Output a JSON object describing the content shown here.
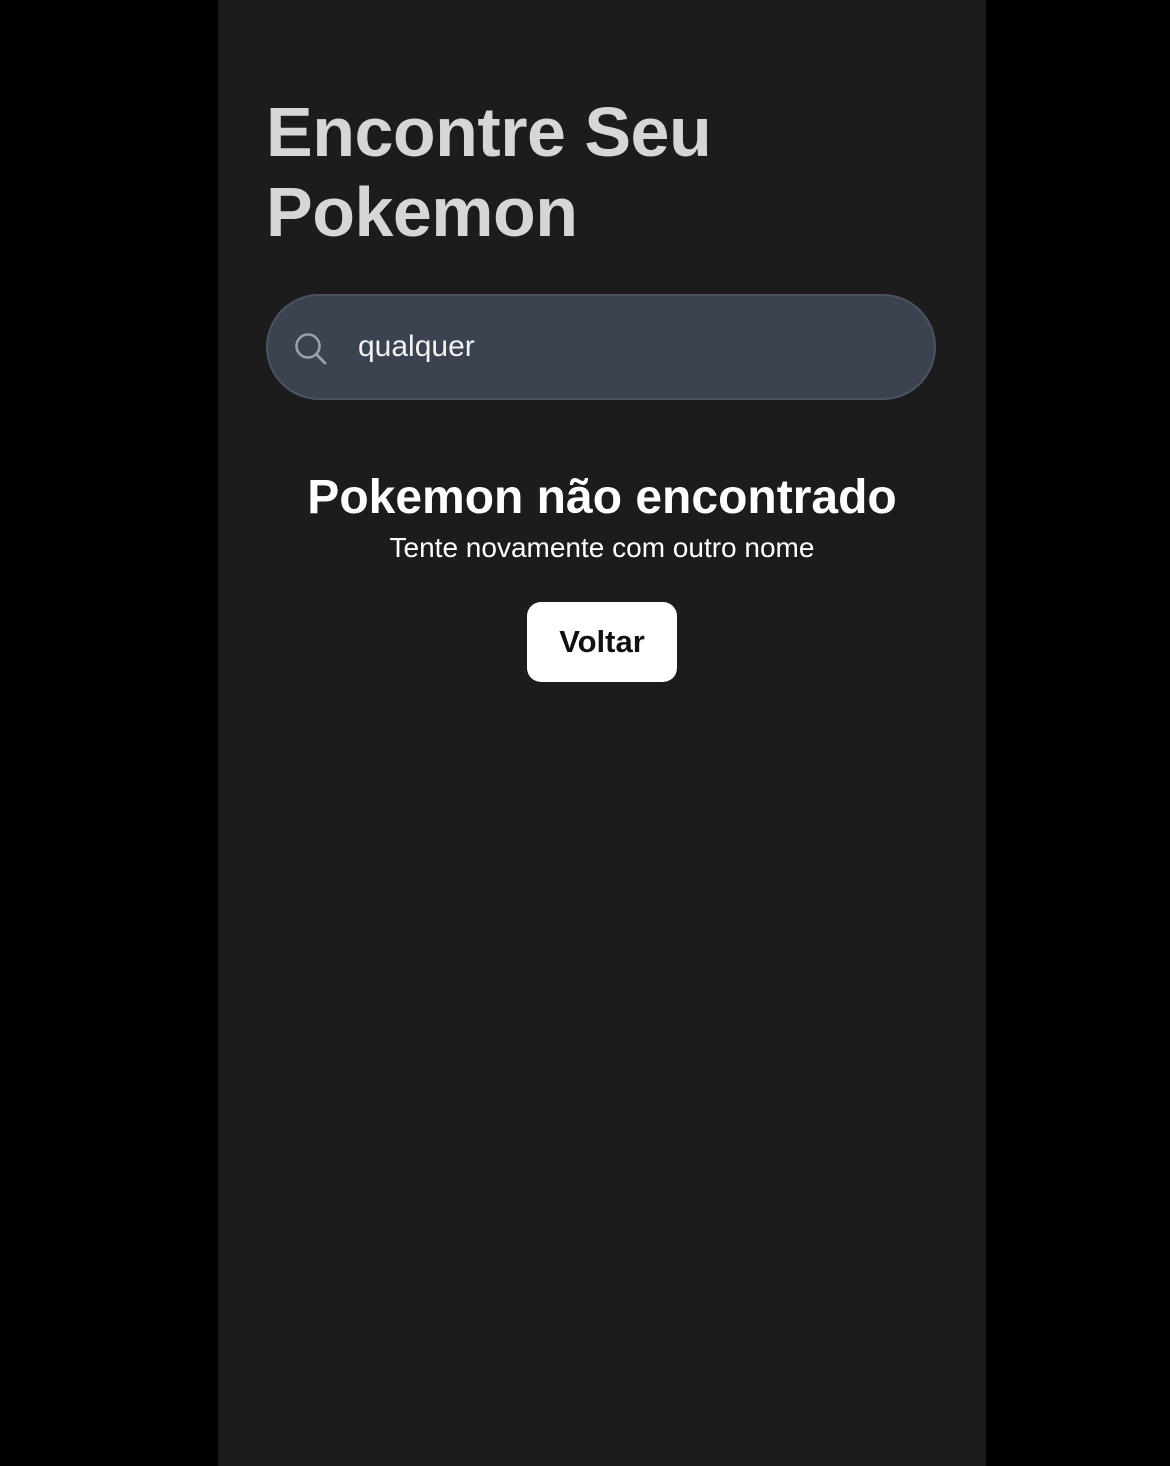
{
  "header": {
    "title": "Encontre Seu Pokemon"
  },
  "search": {
    "value": "qualquer",
    "icon": "search-icon"
  },
  "result": {
    "title": "Pokemon não encontrado",
    "subtitle": "Tente novamente com outro nome",
    "back_label": "Voltar"
  },
  "colors": {
    "outer_background": "#000000",
    "panel_background": "#1c1c1c",
    "search_background": "#3b4250",
    "title_text": "#d6d6d6",
    "button_background": "#ffffff"
  }
}
